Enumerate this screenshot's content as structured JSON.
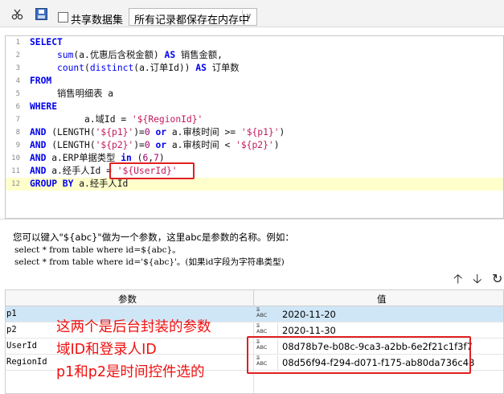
{
  "toolbar": {
    "cut_icon": "scissors-icon",
    "save_icon": "save-icon",
    "share_dataset_label": "共享数据集",
    "share_dataset_checked": false,
    "storage_mode_value": "所有记录都保存在内存中"
  },
  "editor": {
    "line_numbers": [
      "1",
      "2",
      "3",
      "4",
      "5",
      "6",
      "7",
      "8",
      "9",
      "10",
      "11",
      "12"
    ],
    "lines": [
      {
        "segments": [
          {
            "t": "SELECT",
            "c": "kw"
          }
        ]
      },
      {
        "segments": [
          {
            "t": "     ",
            "c": "pl"
          },
          {
            "t": "sum",
            "c": "fn"
          },
          {
            "t": "(a.优惠后含税金额) ",
            "c": "pl"
          },
          {
            "t": "AS",
            "c": "kw"
          },
          {
            "t": " 销售金额,",
            "c": "pl"
          }
        ]
      },
      {
        "segments": [
          {
            "t": "     ",
            "c": "pl"
          },
          {
            "t": "count",
            "c": "fn"
          },
          {
            "t": "(",
            "c": "pl"
          },
          {
            "t": "distinct",
            "c": "fn"
          },
          {
            "t": "(a.订单Id)) ",
            "c": "pl"
          },
          {
            "t": "AS",
            "c": "kw"
          },
          {
            "t": " 订单数",
            "c": "pl"
          }
        ]
      },
      {
        "segments": [
          {
            "t": "FROM",
            "c": "kw"
          }
        ]
      },
      {
        "segments": [
          {
            "t": "     销售明细表 a",
            "c": "pl"
          }
        ]
      },
      {
        "segments": [
          {
            "t": "WHERE",
            "c": "kw"
          }
        ]
      },
      {
        "segments": [
          {
            "t": "          a.域Id = ",
            "c": "pl"
          },
          {
            "t": "'${RegionId}'",
            "c": "str"
          }
        ]
      },
      {
        "segments": [
          {
            "t": "AND",
            "c": "kw"
          },
          {
            "t": " (LENGTH(",
            "c": "pl"
          },
          {
            "t": "'${p1}'",
            "c": "str"
          },
          {
            "t": ")=",
            "c": "pl"
          },
          {
            "t": "0",
            "c": "num"
          },
          {
            "t": " ",
            "c": "pl"
          },
          {
            "t": "or",
            "c": "kw"
          },
          {
            "t": " a.审核时间 >= ",
            "c": "pl"
          },
          {
            "t": "'${p1}'",
            "c": "str"
          },
          {
            "t": ")",
            "c": "pl"
          }
        ]
      },
      {
        "segments": [
          {
            "t": "AND",
            "c": "kw"
          },
          {
            "t": " (LENGTH(",
            "c": "pl"
          },
          {
            "t": "'${p2}'",
            "c": "str"
          },
          {
            "t": ")=",
            "c": "pl"
          },
          {
            "t": "0",
            "c": "num"
          },
          {
            "t": " ",
            "c": "pl"
          },
          {
            "t": "or",
            "c": "kw"
          },
          {
            "t": " a.审核时间 < ",
            "c": "pl"
          },
          {
            "t": "'${p2}'",
            "c": "str"
          },
          {
            "t": ")",
            "c": "pl"
          }
        ]
      },
      {
        "segments": [
          {
            "t": "AND",
            "c": "kw"
          },
          {
            "t": " a.ERP单据类型 ",
            "c": "pl"
          },
          {
            "t": "in",
            "c": "kw"
          },
          {
            "t": " (",
            "c": "pl"
          },
          {
            "t": "6",
            "c": "num"
          },
          {
            "t": ",",
            "c": "pl"
          },
          {
            "t": "7",
            "c": "num"
          },
          {
            "t": ")",
            "c": "pl"
          }
        ]
      },
      {
        "segments": [
          {
            "t": "AND",
            "c": "kw"
          },
          {
            "t": " a.经手人Id = ",
            "c": "pl"
          },
          {
            "t": "'${UserId}'",
            "c": "str"
          }
        ]
      },
      {
        "segments": [
          {
            "t": "GROUP BY",
            "c": "kw"
          },
          {
            "t": " a.经手人Id",
            "c": "pl"
          }
        ]
      }
    ]
  },
  "hint": {
    "line1": "您可以键入\"${abc}\"做为一个参数，这里abc是参数的名称。例如：",
    "line2": "select * from table where id=${abc}。",
    "line3": "select * from table where id='${abc}'。(如果id字段为字符串类型)"
  },
  "param_toolbar": {
    "up_icon": "arrow-up-icon",
    "down_icon": "arrow-down-icon",
    "refresh_icon": "refresh-icon"
  },
  "params_table": {
    "headers": [
      "参数",
      "值"
    ],
    "type_icon": "abc-type-icon",
    "type_top": "a̅",
    "type_bottom": "ABC",
    "rows": [
      {
        "name": "p1",
        "value": "2020-11-20"
      },
      {
        "name": "p2",
        "value": "2020-11-30"
      },
      {
        "name": "UserId",
        "value": "08d78b7e-b08c-9ca3-a2bb-6e2f21c1f3f7"
      },
      {
        "name": "RegionId",
        "value": "08d56f94-f294-d071-f175-ab80da736c48"
      }
    ]
  },
  "annotations": [
    "这两个是后台封装的参数",
    "域ID和登录人ID",
    "p1和p2是时间控件选的"
  ]
}
